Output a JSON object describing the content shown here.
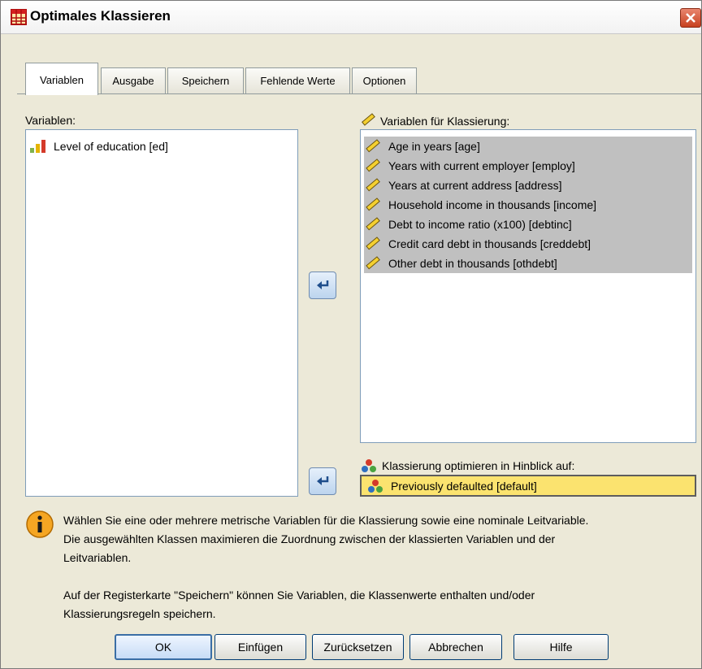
{
  "window": {
    "title": "Optimales Klassieren",
    "colors": {
      "selected_row": "#c0c0c0",
      "target_field": "#fbe36f",
      "arrow_button": "#bcd4ee"
    }
  },
  "tabs": [
    "Variablen",
    "Ausgabe",
    "Speichern",
    "Fehlende Werte",
    "Optionen"
  ],
  "active_tab": "Variablen",
  "source": {
    "label": "Variablen:",
    "items": [
      {
        "label": "Level of education [ed]",
        "icon": "ordinal-bar-icon"
      }
    ]
  },
  "binning": {
    "label": "Variablen für Klassierung:",
    "items": [
      {
        "label": "Age in years [age]",
        "icon": "scale-ruler-icon"
      },
      {
        "label": "Years with current employer [employ]",
        "icon": "scale-ruler-icon"
      },
      {
        "label": "Years at current address [address]",
        "icon": "scale-ruler-icon"
      },
      {
        "label": "Household income in thousands [income]",
        "icon": "scale-ruler-icon"
      },
      {
        "label": "Debt to income ratio (x100) [debtinc]",
        "icon": "scale-ruler-icon"
      },
      {
        "label": "Credit card debt in thousands [creddebt]",
        "icon": "scale-ruler-icon"
      },
      {
        "label": "Other debt in thousands [othdebt]",
        "icon": "scale-ruler-icon"
      }
    ]
  },
  "optimize": {
    "label": "Klassierung optimieren in Hinblick auf:",
    "value": "Previously defaulted [default]",
    "icon": "nominal-circles-icon"
  },
  "info": {
    "p1_l1": "Wählen Sie eine oder mehrere metrische Variablen für die Klassierung sowie eine nominale Leitvariable.",
    "p1_l2": "Die ausgewählten Klassen maximieren die Zuordnung zwischen der klassierten Variablen und der",
    "p1_l3": "Leitvariablen.",
    "p2_l1": "Auf der Registerkarte \"Speichern\" können Sie  Variablen, die Klassenwerte enthalten und/oder",
    "p2_l2": "Klassierungsregeln speichern."
  },
  "buttons": {
    "ok": "OK",
    "paste": "Einfügen",
    "reset": "Zurücksetzen",
    "cancel": "Abbrechen",
    "help": "Hilfe"
  }
}
